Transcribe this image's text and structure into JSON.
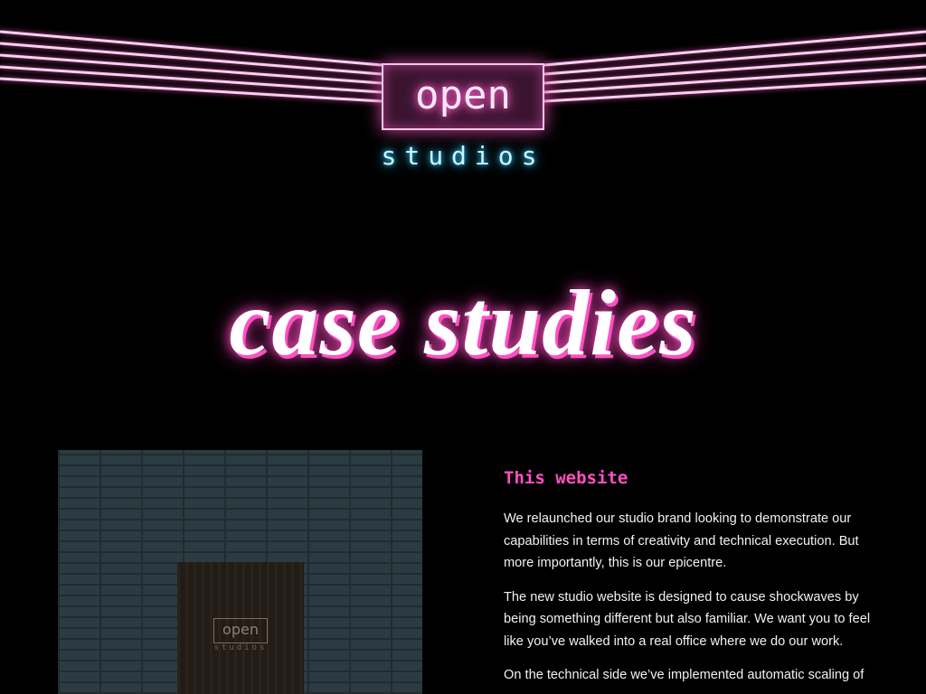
{
  "logo": {
    "top": "open",
    "bottom": "studios"
  },
  "page_title": "case studies",
  "case_image": {
    "door_sign_top": "open",
    "door_sign_bottom": "studios"
  },
  "case": {
    "heading": "This website",
    "paragraphs": [
      "We relaunched our studio brand looking to demonstrate our capabilities in terms of creativity and technical execution. But more importantly, this is our epicentre.",
      "The new studio website is designed to cause shockwaves by being something different but also familiar. We want you to feel like you’ve walked into a real office where we do our work.",
      "On the technical side we’ve implemented automatic scaling of"
    ]
  },
  "colors": {
    "pink": "#ff4fc4",
    "cyan": "#2fc7ff",
    "neon_line": "#f6c6ea"
  }
}
